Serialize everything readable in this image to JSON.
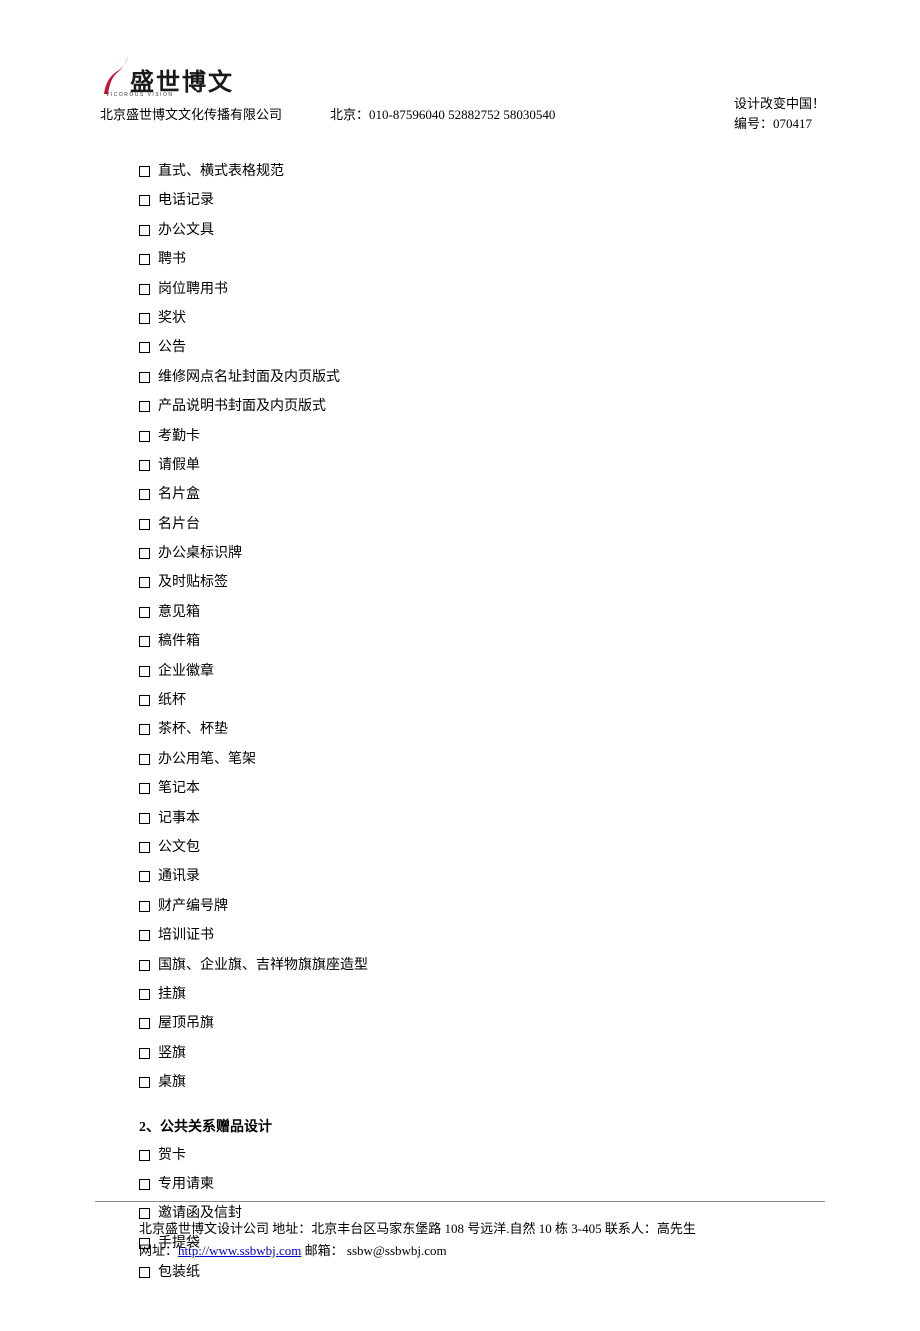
{
  "header": {
    "logo_text": "盛世博文",
    "logo_sub": "VICOROUS VISION",
    "company": "北京盛世博文文化传播有限公司",
    "phone_label": "北京：",
    "phone_numbers": "010-87596040    52882752    58030540",
    "slogan": "设计改变中国！",
    "serial_label": "编号：",
    "serial_number": "070417"
  },
  "section1_items": [
    "直式、横式表格规范",
    "电话记录",
    "办公文具",
    "聘书",
    "岗位聘用书",
    "奖状",
    "公告",
    "维修网点名址封面及内页版式",
    "产品说明书封面及内页版式",
    "考勤卡",
    "请假单",
    "名片盒",
    "名片台",
    "办公桌标识牌",
    "及时贴标签",
    "意见箱",
    "稿件箱",
    "企业徽章",
    "纸杯",
    "茶杯、杯垫",
    "办公用笔、笔架",
    "笔记本",
    "记事本",
    "公文包",
    "通讯录",
    "财产编号牌",
    "培训证书",
    "国旗、企业旗、吉祥物旗旗座造型",
    "挂旗",
    "屋顶吊旗",
    "竖旗",
    "桌旗"
  ],
  "section2": {
    "heading": "2、公共关系赠品设计",
    "items": [
      "贺卡",
      "专用请柬",
      "邀请函及信封",
      "手提袋",
      "包装纸"
    ]
  },
  "footer": {
    "line1_prefix": "北京盛世博文设计公司      地址：北京丰台区马家东堡路 108 号远洋.自然 10 栋 3-405 联系人：高先生",
    "line2_prefix": "网址：",
    "url": "http://www.ssbwbj.com",
    "line2_mid": "      邮箱：    ",
    "email": "ssbw@ssbwbj.com"
  }
}
